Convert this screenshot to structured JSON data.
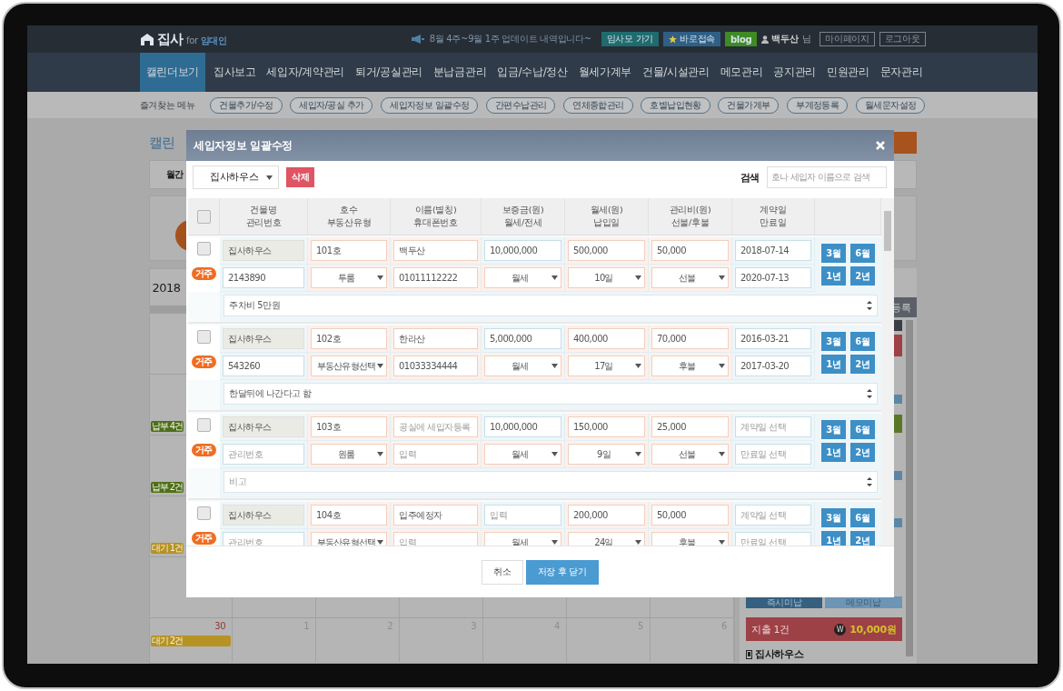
{
  "header": {
    "logo": {
      "brand": "집사",
      "for": "for",
      "audience": "임대인"
    },
    "notice": "8월 4주~9월 1주 업데이트 내역입니다~",
    "links": [
      {
        "label": "임사모 가기",
        "kind": "teal"
      },
      {
        "label": "바로접속",
        "kind": "star"
      },
      {
        "label": "blog",
        "kind": "green"
      }
    ],
    "user": {
      "name": "백두산",
      "honorific": "님"
    },
    "account_links": [
      "마이페이지",
      "로그아웃"
    ]
  },
  "nav": [
    {
      "label": "캘린더보기",
      "selected": true
    },
    {
      "label": "집사보고",
      "selected": false
    },
    {
      "label": "세입자/계약관리",
      "selected": false
    },
    {
      "label": "퇴거/공실관리",
      "selected": false
    },
    {
      "label": "분납금관리",
      "selected": false
    },
    {
      "label": "입금/수납/정산",
      "selected": false
    },
    {
      "label": "월세가계부",
      "selected": false
    },
    {
      "label": "건물/시설관리",
      "selected": false
    },
    {
      "label": "메모관리",
      "selected": false
    },
    {
      "label": "공지관리",
      "selected": false
    },
    {
      "label": "민원관리",
      "selected": false
    },
    {
      "label": "문자관리",
      "selected": false
    }
  ],
  "quick_menu": {
    "label": "즐겨찾는 메뉴",
    "items": [
      "건물추가/수정",
      "세입자/공실 추가",
      "세입자정보 일괄수정",
      "간편수납관리",
      "연체종합관리",
      "호별납입현황",
      "건물가계부",
      "부계정등록",
      "월세문자설정"
    ]
  },
  "page": {
    "heading": "캘린",
    "view_tab": "월간",
    "calendar_title": "2018",
    "weeks": [
      {
        "kind": "blank"
      },
      {
        "kind": "tagged",
        "tag": "납부 4건",
        "color": "#4d6f1c"
      },
      {
        "kind": "tagged",
        "tag": "납부 2건",
        "color": "#4d6f1c"
      },
      {
        "kind": "tagged",
        "tag": "대기 1건",
        "color": "#b79224"
      },
      {
        "kind": "blank"
      }
    ],
    "last_week": {
      "day": "30",
      "tag": "대기 2건",
      "color": "#b79224",
      "next_days": [
        "1",
        "2",
        "3",
        "4",
        "5",
        "6"
      ]
    },
    "side": {
      "button": "등록",
      "tabs": [
        "즉시미납",
        "메모미납"
      ],
      "expense": {
        "label": "지출 1건",
        "currency_symbol": "W",
        "amount": "10,000원"
      },
      "building": "집사하우스"
    }
  },
  "dialog": {
    "title": "세입자정보 일괄수정",
    "building_select": "집사하우스",
    "delete_button": "삭제",
    "search_label": "검색",
    "search": {
      "placeholder": "호나 세입자 이름으로 검색"
    },
    "all_checked": false,
    "columns": [
      {
        "label": "건물명",
        "sublabel": "관리번호"
      },
      {
        "label": "호수",
        "sublabel": "부동산유형"
      },
      {
        "label": "이름(별칭)",
        "sublabel": "휴대폰번호"
      },
      {
        "label": "보증금(원)",
        "sublabel": "월세/전세"
      },
      {
        "label": "월세(원)",
        "sublabel": "납입일"
      },
      {
        "label": "관리비(원)",
        "sublabel": "선불/후불"
      },
      {
        "label": "계약일",
        "sublabel": "만료일"
      }
    ],
    "rows": [
      {
        "checked": false,
        "status": "거주",
        "building": {
          "value": "집사하우스"
        },
        "unit": {
          "value": "101호"
        },
        "name": {
          "value": "백두산"
        },
        "deposit": {
          "value": "10,000,000"
        },
        "rent": {
          "value": "500,000"
        },
        "fee": {
          "value": "50,000"
        },
        "start": {
          "value": "2018-07-14"
        },
        "code": {
          "value": "2143890"
        },
        "property_type": "투룸",
        "phone": {
          "value": "01011112222"
        },
        "lease_type": "월세",
        "pay_day": "10일",
        "fee_timing": "선불",
        "end": {
          "value": "2020-07-13"
        },
        "periods": [
          "3월",
          "6월",
          "1년",
          "2년"
        ],
        "memo": {
          "value": "주차비 5만원"
        }
      },
      {
        "checked": false,
        "status": "거주",
        "building": {
          "value": "집사하우스"
        },
        "unit": {
          "value": "102호"
        },
        "name": {
          "value": "한라산"
        },
        "deposit": {
          "value": "5,000,000"
        },
        "rent": {
          "value": "400,000"
        },
        "fee": {
          "value": "70,000"
        },
        "start": {
          "value": "2016-03-21"
        },
        "code": {
          "value": "543260"
        },
        "property_type": "부동산유형선택",
        "phone": {
          "value": "01033334444"
        },
        "lease_type": "월세",
        "pay_day": "17일",
        "fee_timing": "후불",
        "end": {
          "value": "2017-03-20"
        },
        "periods": [
          "3월",
          "6월",
          "1년",
          "2년"
        ],
        "memo": {
          "value": "한달뒤에 나간다고 함"
        }
      },
      {
        "checked": false,
        "status": "거주",
        "building": {
          "value": "집사하우스"
        },
        "unit": {
          "value": "103호"
        },
        "name": {
          "placeholder": "공실에 세입자등록"
        },
        "deposit": {
          "value": "10,000,000"
        },
        "rent": {
          "value": "150,000"
        },
        "fee": {
          "value": "25,000"
        },
        "start": {
          "placeholder": "계약일 선택"
        },
        "code": {
          "placeholder": "관리번호"
        },
        "property_type": "원룸",
        "phone": {
          "placeholder": "입력"
        },
        "lease_type": "월세",
        "pay_day": "9일",
        "fee_timing": "선불",
        "end": {
          "placeholder": "만료일 선택"
        },
        "periods": [
          "3월",
          "6월",
          "1년",
          "2년"
        ],
        "memo": {
          "placeholder": "비고"
        }
      },
      {
        "checked": false,
        "status": "거주",
        "building": {
          "value": "집사하우스"
        },
        "unit": {
          "value": "104호"
        },
        "name": {
          "value": "입주예정자"
        },
        "deposit": {
          "placeholder": "입력"
        },
        "rent": {
          "value": "200,000"
        },
        "fee": {
          "value": "50,000"
        },
        "start": {
          "placeholder": "계약일 선택"
        },
        "code": {
          "placeholder": "관리번호"
        },
        "property_type": "부동산유형선택",
        "phone": {
          "placeholder": "입력"
        },
        "lease_type": "월세",
        "pay_day": "24일",
        "fee_timing": "후불",
        "end": {
          "placeholder": "만료일 선택"
        },
        "periods": [
          "3월",
          "6월",
          "1년",
          "2년"
        ]
      }
    ],
    "cancel_button": "취소",
    "save_button": "저장 후 닫기"
  }
}
